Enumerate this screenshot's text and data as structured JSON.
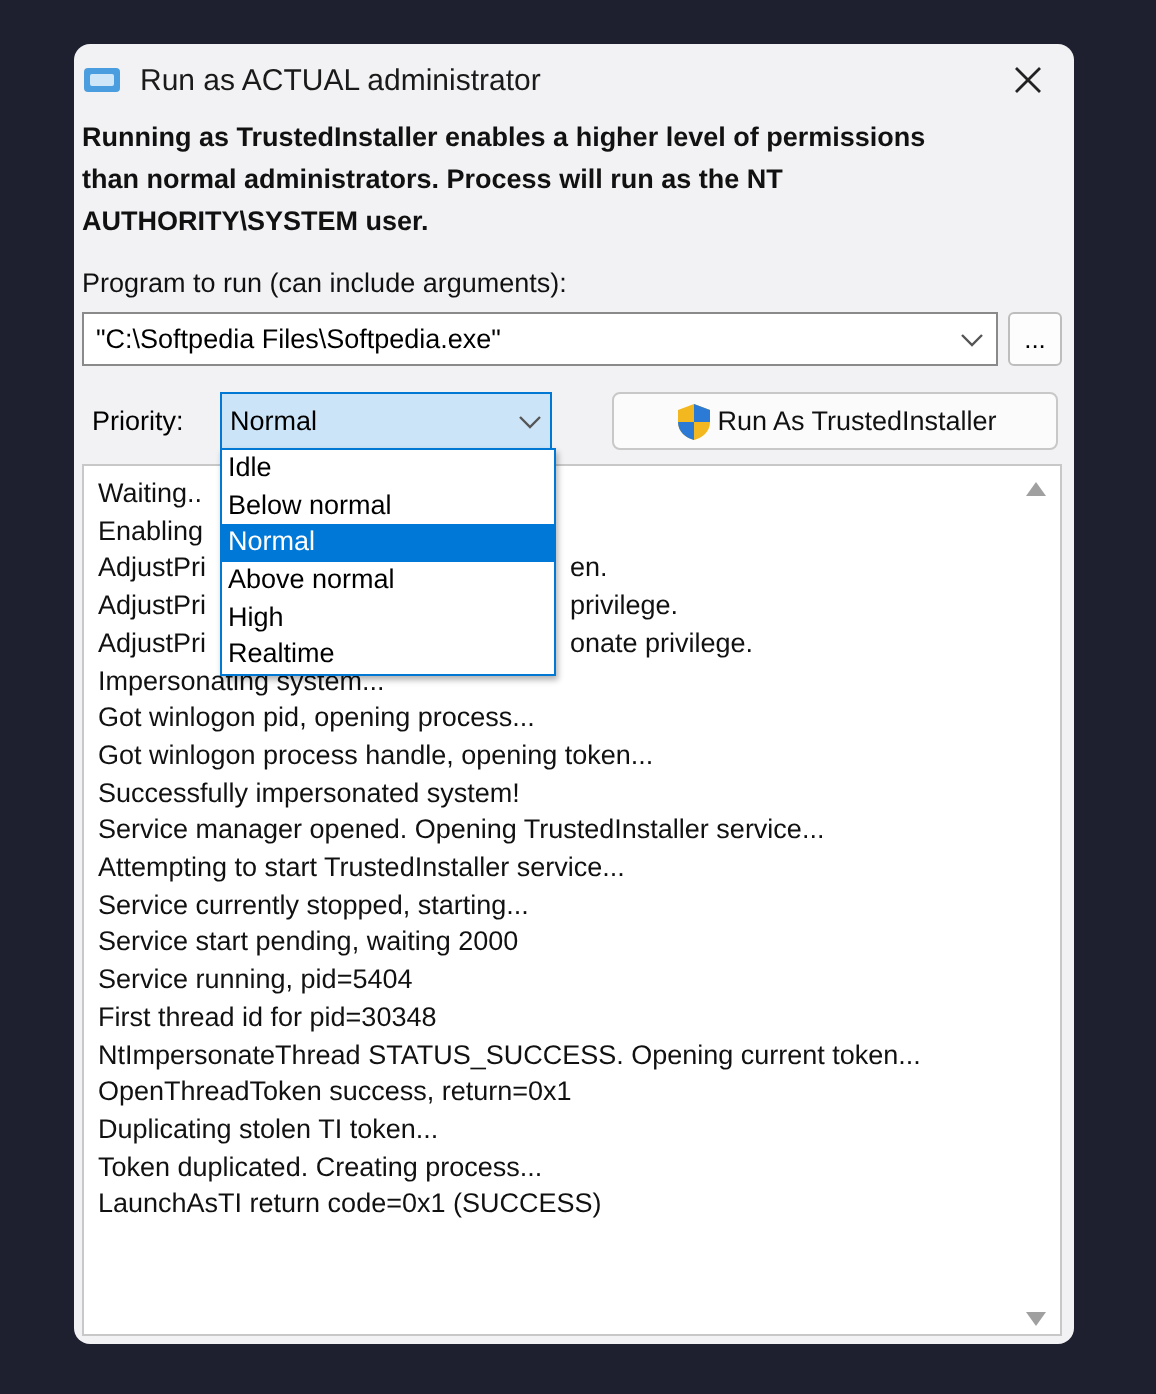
{
  "window": {
    "title": "Run as ACTUAL administrator"
  },
  "description": "Running as TrustedInstaller enables a higher level of permissions than normal administrators. Process will run as the NT AUTHORITY\\SYSTEM user.",
  "program": {
    "label": "Program to run (can include arguments):",
    "value": "\"C:\\Softpedia Files\\Softpedia.exe\"",
    "browse_button": "..."
  },
  "priority": {
    "label": "Priority:",
    "value": "Normal",
    "expanded": true,
    "options": [
      {
        "label": "Idle",
        "selected": false
      },
      {
        "label": "Below normal",
        "selected": false
      },
      {
        "label": "Normal",
        "selected": true
      },
      {
        "label": "Above normal",
        "selected": false
      },
      {
        "label": "High",
        "selected": false
      },
      {
        "label": "Realtime",
        "selected": false
      }
    ]
  },
  "run_button": "Run As TrustedInstaller",
  "log": {
    "lines": [
      {
        "text": "Waiting.."
      },
      {
        "text": "Enabling"
      },
      {
        "text": "AdjustPri",
        "tail": "en."
      },
      {
        "text": "AdjustPri",
        "tail": "privilege."
      },
      {
        "text": "AdjustPri",
        "tail": "onate privilege."
      },
      {
        "text": "Impersonating system..."
      },
      {
        "text": "Got winlogon pid, opening process..."
      },
      {
        "text": "Got winlogon process handle, opening token..."
      },
      {
        "text": "Successfully impersonated system!"
      },
      {
        "text": "Service manager opened. Opening TrustedInstaller service..."
      },
      {
        "text": "Attempting to start TrustedInstaller service..."
      },
      {
        "text": "Service currently stopped, starting..."
      },
      {
        "text": "Service start pending, waiting 2000"
      },
      {
        "text": "Service running, pid=5404"
      },
      {
        "text": "First thread id for pid=30348"
      },
      {
        "text": "NtImpersonateThread STATUS_SUCCESS. Opening current token..."
      },
      {
        "text": "OpenThreadToken success, return=0x1"
      },
      {
        "text": "Duplicating stolen TI token..."
      },
      {
        "text": "Token duplicated. Creating process..."
      },
      {
        "text": "LaunchAsTI return code=0x1 (SUCCESS)"
      }
    ]
  }
}
